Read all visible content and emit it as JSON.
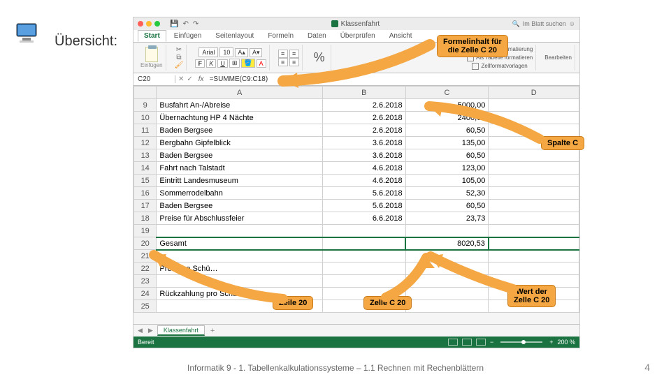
{
  "slide": {
    "title": "Übersicht:",
    "footer": "Informatik 9 - 1. Tabellenkalkulationssysteme – 1.1 Rechnen mit Rechenblättern",
    "page": "4"
  },
  "excel": {
    "doc_title": "Klassenfahrt",
    "search_placeholder": "Im Blatt suchen",
    "tabs": [
      "Start",
      "Einfügen",
      "Seitenlayout",
      "Formeln",
      "Daten",
      "Überprüfen",
      "Ansicht"
    ],
    "ribbon": {
      "paste": "Einfügen",
      "font": "Arial",
      "font_size": "10",
      "bold": "F",
      "italic": "K",
      "underline": "U",
      "bedingte": "Bedingte Formatierung",
      "als_tabelle": "Als Tabelle formatieren",
      "zellformat": "Zellformatvorlagen",
      "bearbeiten": "Bearbeiten"
    },
    "name_box": "C20",
    "formula": "=SUMME(C9:C18)",
    "columns": [
      "A",
      "B",
      "C",
      "D"
    ],
    "rows": [
      {
        "n": "9",
        "a": "Busfahrt An-/Abreise",
        "b": "2.6.2018",
        "c": "5000,00",
        "d": ""
      },
      {
        "n": "10",
        "a": "Übernachtung HP 4 Nächte",
        "b": "2.6.2018",
        "c": "2400,00",
        "d": ""
      },
      {
        "n": "11",
        "a": "Baden Bergsee",
        "b": "2.6.2018",
        "c": "60,50",
        "d": ""
      },
      {
        "n": "12",
        "a": "Bergbahn Gipfelblick",
        "b": "3.6.2018",
        "c": "135,00",
        "d": ""
      },
      {
        "n": "13",
        "a": "Baden Bergsee",
        "b": "3.6.2018",
        "c": "60,50",
        "d": ""
      },
      {
        "n": "14",
        "a": "Fahrt nach Talstadt",
        "b": "4.6.2018",
        "c": "123,00",
        "d": ""
      },
      {
        "n": "15",
        "a": "Eintritt Landesmuseum",
        "b": "4.6.2018",
        "c": "105,00",
        "d": ""
      },
      {
        "n": "16",
        "a": "Sommerrodelbahn",
        "b": "5.6.2018",
        "c": "52,30",
        "d": ""
      },
      {
        "n": "17",
        "a": "Baden Bergsee",
        "b": "5.6.2018",
        "c": "60,50",
        "d": ""
      },
      {
        "n": "18",
        "a": "Preise für Abschlussfeier",
        "b": "6.6.2018",
        "c": "23,73",
        "d": ""
      },
      {
        "n": "19",
        "a": "",
        "b": "",
        "c": "",
        "d": ""
      },
      {
        "n": "20",
        "a": "Gesamt",
        "b": "",
        "c": "8020,53",
        "d": ""
      },
      {
        "n": "21",
        "a": "",
        "b": "",
        "c": "",
        "d": ""
      },
      {
        "n": "22",
        "a": "Preis pro Schü…",
        "b": "",
        "c": "",
        "d": ""
      },
      {
        "n": "23",
        "a": "",
        "b": "",
        "c": "",
        "d": ""
      },
      {
        "n": "24",
        "a": "Rückzahlung pro Schüle…",
        "b": "",
        "c": "",
        "d": ""
      },
      {
        "n": "25",
        "a": "",
        "b": "",
        "c": "",
        "d": ""
      }
    ],
    "sheet_tab": "Klassenfahrt",
    "status": "Bereit",
    "zoom": "200 %"
  },
  "callouts": {
    "formelinhalt": "Formelinhalt für\ndie Zelle C 20",
    "spalte_c": "Spalte C",
    "zeile20": "Zeile 20",
    "zelle_c20": "Zelle C 20",
    "wert_c20": "Wert der\nZelle C 20"
  }
}
